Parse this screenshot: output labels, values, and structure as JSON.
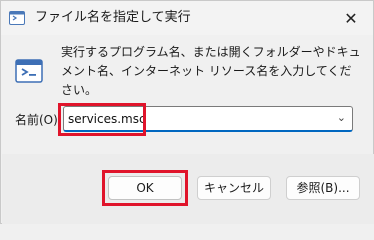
{
  "window": {
    "title": "ファイル名を指定して実行",
    "close_glyph": "✕"
  },
  "description": "実行するプログラム名、または開くフォルダーやドキュメント名、インターネット リソース名を入力してください。",
  "open_field": {
    "label": "名前(O):",
    "value": "services.msc"
  },
  "buttons": {
    "ok": "OK",
    "cancel": "キャンセル",
    "browse": "参照(B)..."
  },
  "icons": {
    "title": "run-app-icon",
    "body": "run-app-icon",
    "dropdown": "chevron-down-icon"
  },
  "colors": {
    "highlight": "#e0142b",
    "focus_underline": "#0067c0"
  }
}
